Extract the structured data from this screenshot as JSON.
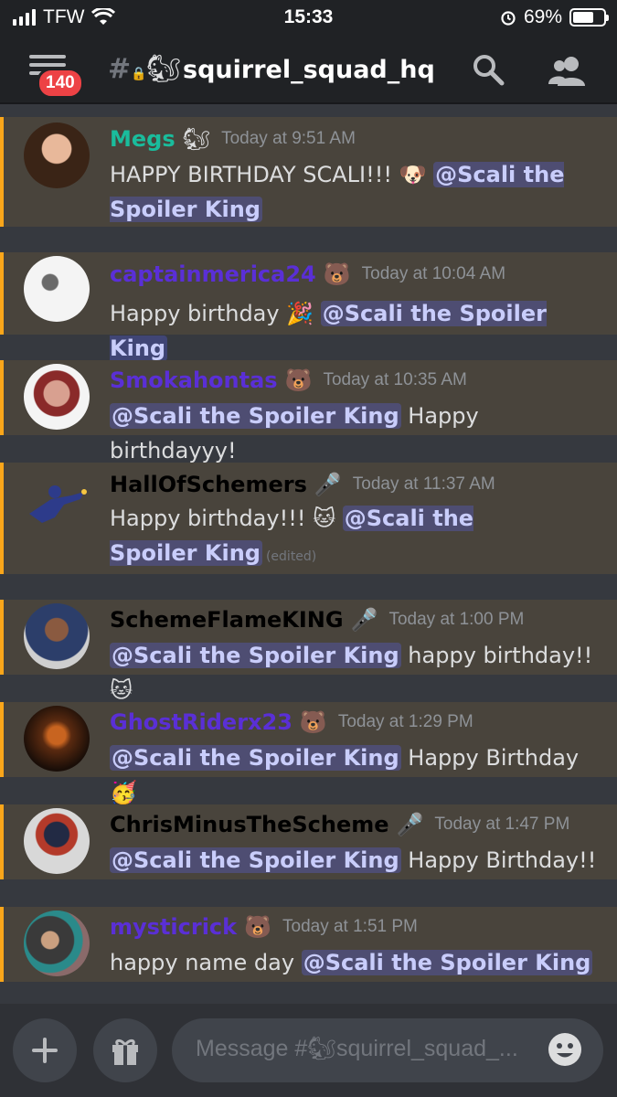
{
  "status_bar": {
    "carrier": "TFW",
    "time": "15:33",
    "battery": "69%",
    "battery_level": 0.69
  },
  "header": {
    "unread_count": "140",
    "channel_icon": "lock-hash-icon",
    "channel_emoji": "🐿",
    "channel_name": "squirrel_squad_hq"
  },
  "messages": [
    {
      "username": "Megs",
      "name_color": "#1abc9c",
      "badge": "🐿",
      "timestamp": "Today at 9:51 AM",
      "text_before": "HAPPY BIRTHDAY SCALI!!! 🐶 ",
      "mention": "@Scali the Spoiler King",
      "text_after": "",
      "edited": ""
    },
    {
      "username": "captainmerica24",
      "name_color": "#5a2fd6",
      "badge": "🐻",
      "timestamp": "Today at 10:04 AM",
      "text_before": "Happy birthday 🎉 ",
      "mention": "@Scali the Spoiler King",
      "text_after": "",
      "edited": ""
    },
    {
      "username": "Smokahontas",
      "name_color": "#5a2fd6",
      "badge": "🐻",
      "timestamp": "Today at 10:35 AM",
      "text_before": "",
      "mention": "@Scali the Spoiler King",
      "text_after": " Happy birthdayyy!",
      "edited": ""
    },
    {
      "username": "HallOfSchemers",
      "name_color": "#000000",
      "badge": "🎤",
      "timestamp": "Today at 11:37 AM",
      "text_before": "Happy birthday!!! 🐱 ",
      "mention": "@Scali the Spoiler King",
      "text_after": "",
      "edited": "(edited)"
    },
    {
      "username": "SchemeFlameKING",
      "name_color": "#000000",
      "badge": "🎤",
      "timestamp": "Today at 1:00 PM",
      "text_before": "",
      "mention": "@Scali the Spoiler King",
      "text_after": " happy birthday!! 🐱",
      "edited": ""
    },
    {
      "username": "GhostRiderx23",
      "name_color": "#5a2fd6",
      "badge": "🐻",
      "timestamp": "Today at 1:29 PM",
      "text_before": "",
      "mention": "@Scali the Spoiler King",
      "text_after": "  Happy Birthday 🥳",
      "edited": ""
    },
    {
      "username": "ChrisMinusTheScheme",
      "name_color": "#000000",
      "badge": "🎤",
      "timestamp": "Today at 1:47 PM",
      "text_before": "",
      "mention": "@Scali the Spoiler King",
      "text_after": " Happy Birthday!!",
      "edited": ""
    },
    {
      "username": "mysticrick",
      "name_color": "#5a2fd6",
      "badge": "🐻",
      "timestamp": "Today at 1:51 PM",
      "text_before": "happy name day ",
      "mention": "@Scali the Spoiler King",
      "text_after": "",
      "edited": ""
    }
  ],
  "input": {
    "placeholder": "Message #🐿squirrel_squad_..."
  },
  "colors": {
    "mention_bg": "#4e4f8a",
    "highlight_bar": "#faa61a",
    "message_bg": "#49443c",
    "background": "#36393f"
  }
}
